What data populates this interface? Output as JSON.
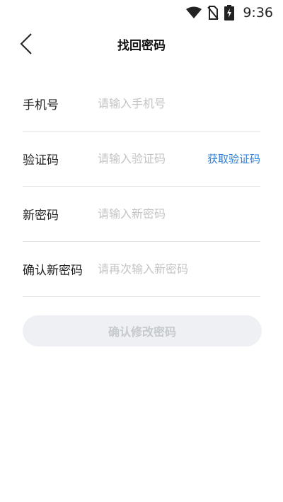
{
  "status_bar": {
    "time": "9:36",
    "icons": [
      "wifi-icon",
      "no-sim-icon",
      "battery-charging-icon"
    ]
  },
  "header": {
    "title": "找回密码",
    "back_icon": "chevron-left-icon"
  },
  "form": {
    "phone": {
      "label": "手机号",
      "placeholder": "请输入手机号",
      "value": ""
    },
    "code": {
      "label": "验证码",
      "placeholder": "请输入验证码",
      "value": "",
      "action_label": "获取验证码"
    },
    "new_password": {
      "label": "新密码",
      "placeholder": "请输入新密码",
      "value": ""
    },
    "confirm_password": {
      "label": "确认新密码",
      "placeholder": "请再次输入新密码",
      "value": ""
    }
  },
  "submit": {
    "label": "确认修改密码",
    "disabled": true
  },
  "colors": {
    "accent": "#2f7fd6",
    "button_bg": "#eef0f3",
    "button_text": "#c6c9cd",
    "placeholder": "#c3c3c3",
    "divider": "#e3e3e3"
  }
}
